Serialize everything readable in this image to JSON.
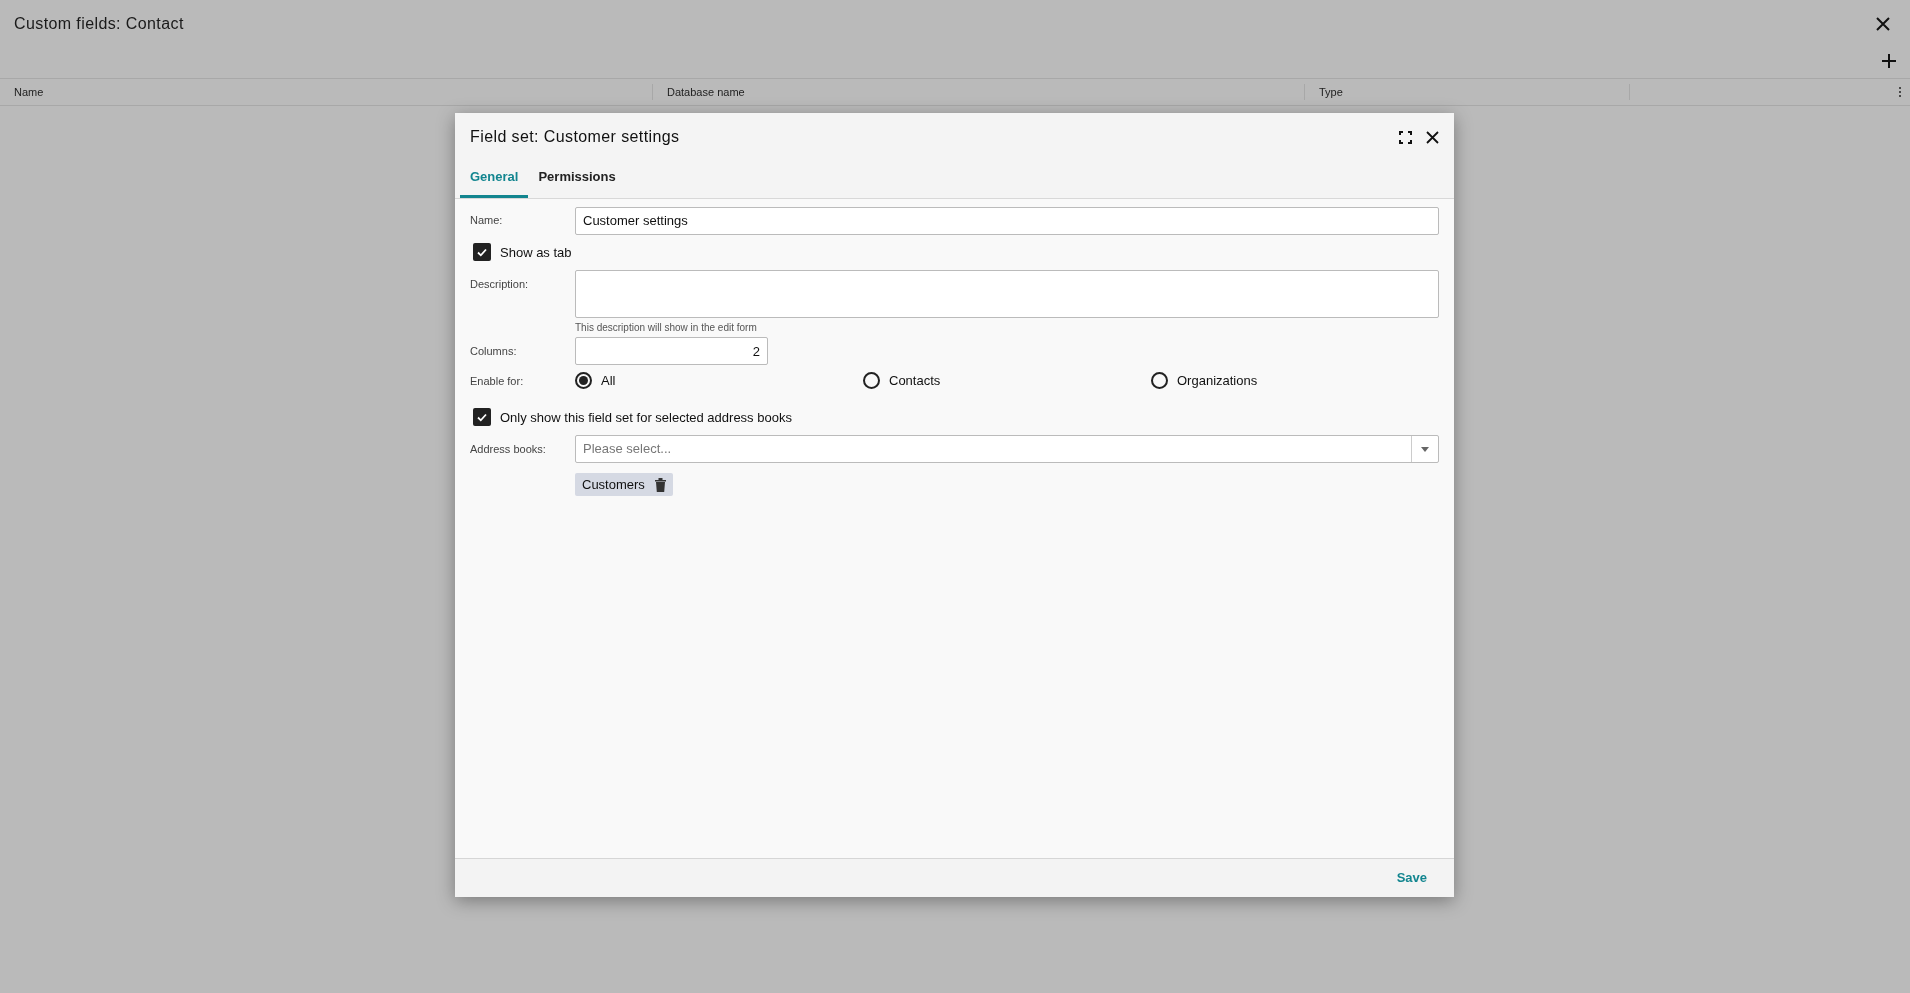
{
  "page": {
    "title": "Custom fields: Contact",
    "columns": [
      "Name",
      "Database name",
      "Type"
    ]
  },
  "dialog": {
    "title": "Field set: Customer settings",
    "tabs": [
      {
        "label": "General",
        "selected": true
      },
      {
        "label": "Permissions",
        "selected": false
      }
    ],
    "name": {
      "label": "Name:",
      "value": "Customer settings"
    },
    "show_as_tab": {
      "label": "Show as tab",
      "checked": true
    },
    "description": {
      "label": "Description:",
      "hint": "This description will show in the edit form"
    },
    "columns": {
      "label": "Columns:",
      "value": "2"
    },
    "enable_for": {
      "label": "Enable for:",
      "options": [
        {
          "label": "All",
          "selected": true
        },
        {
          "label": "Contacts",
          "selected": false
        },
        {
          "label": "Organizations",
          "selected": false
        }
      ]
    },
    "only_selected": {
      "label": "Only show this field set for selected address books",
      "checked": true
    },
    "address_books": {
      "label": "Address books:",
      "placeholder": "Please select...",
      "chips": [
        "Customers"
      ]
    },
    "save": "Save"
  }
}
